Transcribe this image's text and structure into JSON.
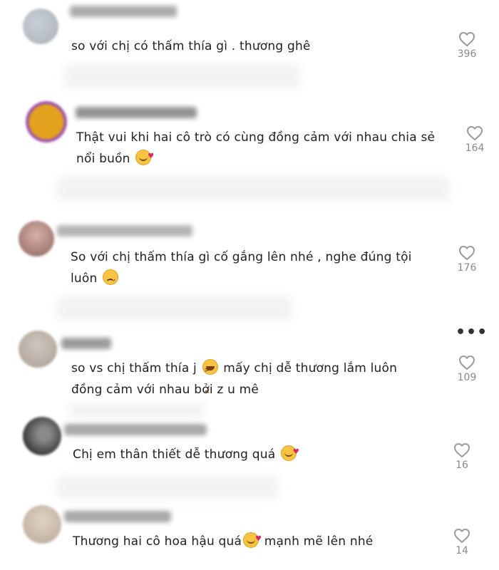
{
  "comments": [
    {
      "text": "so với chị có thấm thía gì . thương ghê",
      "emoji": "",
      "likes": "396"
    },
    {
      "text": "Thật vui khi hai cô trò có cùng đồng cảm với nhau chia sẻ nổi buồn",
      "emoji": "smiling-face-with-hearts",
      "likes": "164"
    },
    {
      "text": "So với chị thấm thía gì cố gắng lên nhé , nghe đúng tội luôn",
      "emoji": "frowning-face",
      "likes": "176"
    },
    {
      "text_before": "so vs chị thấm thía j",
      "text_after": "mấy chị dễ thương lắm luôn đồng cảm với nhau bởi z u mê",
      "emoji": "laughing-face",
      "likes": "109"
    },
    {
      "text": "Chị em thân thiết dễ thương quá",
      "emoji": "smiling-face-with-hearts",
      "likes": "16"
    },
    {
      "text_before": "Thương hai cô hoa hậu quá",
      "text_after": "mạnh mẽ lên nhé",
      "emoji": "smiling-face-with-hearts",
      "likes": "14"
    }
  ],
  "more_menu_glyph": "•••",
  "colors": {
    "text": "#222222",
    "muted": "#8a8a8a",
    "heart_outline": "#9a9a9a"
  }
}
